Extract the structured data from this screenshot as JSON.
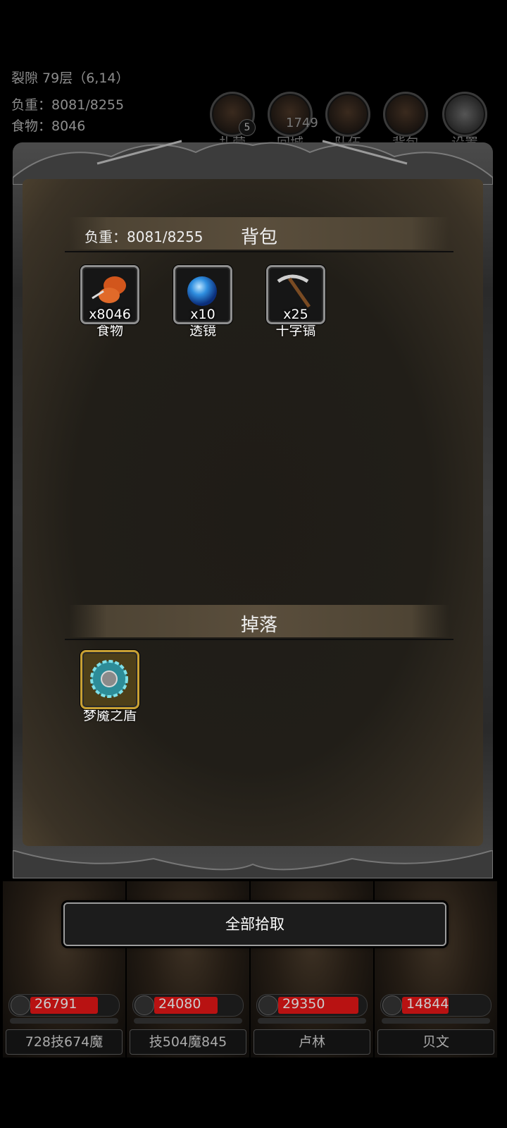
{
  "hud": {
    "location": "裂隙 79层（6,14）",
    "weight": "负重：8081/8255",
    "food": "食物：8046"
  },
  "top_menu": [
    {
      "label": "扎营",
      "icon": "campfire-icon",
      "badge": "5"
    },
    {
      "label": "回城",
      "icon": "portal-icon",
      "count": "1749"
    },
    {
      "label": "队伍",
      "icon": "banner-icon"
    },
    {
      "label": "背包",
      "icon": "backpack-icon"
    },
    {
      "label": "设置",
      "icon": "gear-icon"
    }
  ],
  "backpack": {
    "title": "背包",
    "weight": "负重：8081/8255",
    "items": [
      {
        "name": "食物",
        "qty": "x8046",
        "icon": "food-icon"
      },
      {
        "name": "透镜",
        "qty": "x10",
        "icon": "lens-icon"
      },
      {
        "name": "十字镐",
        "qty": "x25",
        "icon": "pickaxe-icon"
      }
    ]
  },
  "drops": {
    "title": "掉落",
    "items": [
      {
        "name": "梦魇之盾",
        "icon": "shield-icon"
      }
    ]
  },
  "pickup_all_label": "全部拾取",
  "heroes": [
    {
      "hp": "26791",
      "hp_fraction": 0.8,
      "label": "728技674魔"
    },
    {
      "hp": "24080",
      "hp_fraction": 0.75,
      "label": "技504魔845"
    },
    {
      "hp": "29350",
      "hp_fraction": 0.95,
      "label": "卢林"
    },
    {
      "hp": "14844",
      "hp_fraction": 0.55,
      "label": "贝文"
    }
  ],
  "colors": {
    "hp_bar": "#b81212",
    "drop_highlight": "#c8a033"
  }
}
